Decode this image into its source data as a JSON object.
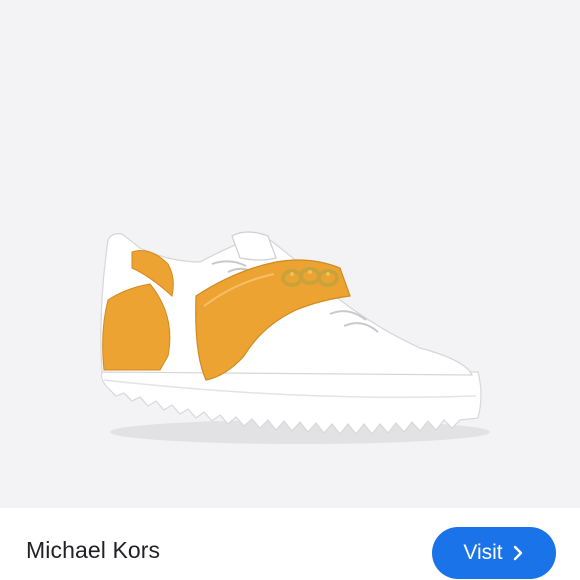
{
  "listing": {
    "brand": "Michael Kors",
    "visit_label": "Visit",
    "visit_icon": "chevron-right-icon"
  },
  "image": {
    "subject": "sneaker",
    "background_color": "#f3f3f5",
    "accent_color": "#eda332"
  },
  "colors": {
    "button": "#1a73e8",
    "button_text": "#ffffff",
    "brand_text": "#202124"
  }
}
